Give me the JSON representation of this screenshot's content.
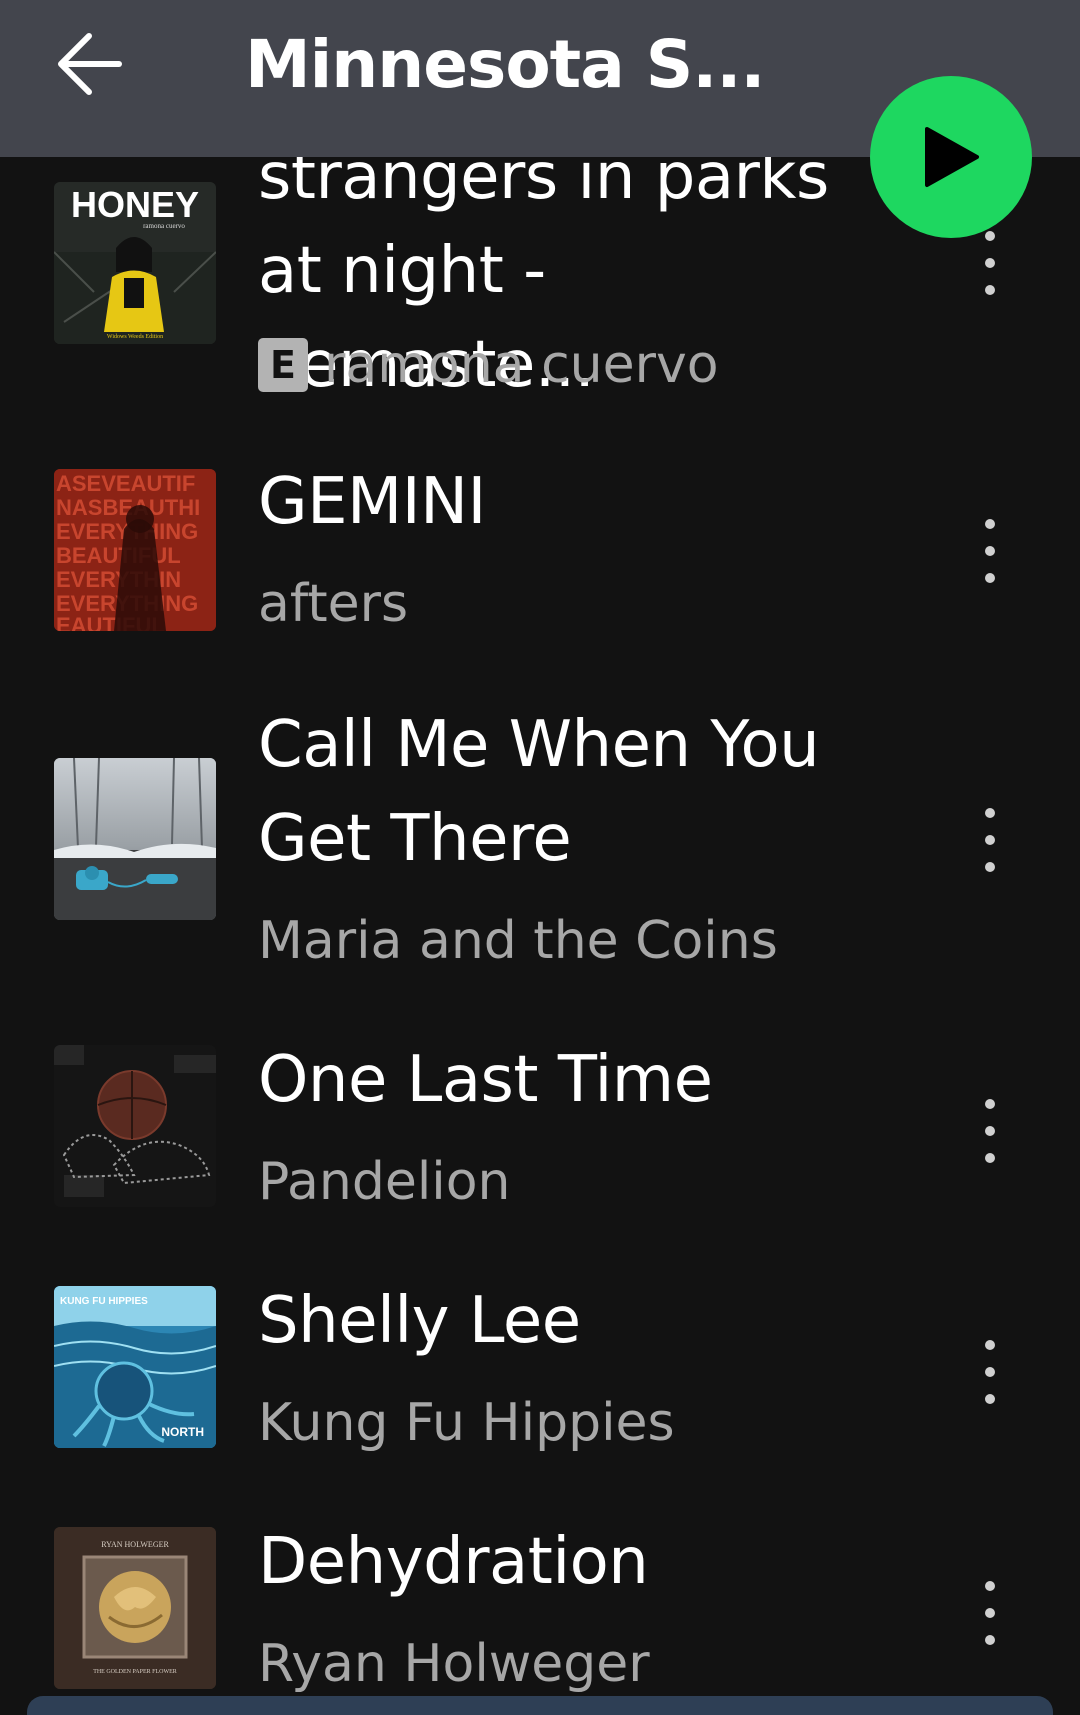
{
  "header": {
    "title": "Minnesota S..."
  },
  "icons": {
    "back": "arrow-left-icon",
    "play": "play-icon",
    "more": "more-vertical-icon"
  },
  "colors": {
    "accent": "#1ed760",
    "header_bg": "#43454d",
    "background": "#121212",
    "secondary_text": "#a7a7a7"
  },
  "tracks": [
    {
      "title_line1": "strangers in parks",
      "title_line2": "at night - Remaste...",
      "explicit_label": "E",
      "artist": "ramona cuervo",
      "art_text": "HONEY",
      "art_subtext": "ramona cuervo",
      "art_footer": "Widows Weeds Edition"
    },
    {
      "title_line1": "GEMINI",
      "artist": "afters",
      "art_text": "ASEVEAUTIFUL NASBEAUTHING EVERYTHING BEAUTIFUL EVERYTHING"
    },
    {
      "title_line1": "Call Me When You",
      "title_line2": "Get There",
      "artist": "Maria and the Coins"
    },
    {
      "title_line1": "One Last Time",
      "artist": "Pandelion"
    },
    {
      "title_line1": "Shelly Lee",
      "artist": "Kung Fu Hippies",
      "art_text": "KUNG FU HIPPIES",
      "art_footer": "NORTH"
    },
    {
      "title_line1": "Dehydration",
      "artist": "Ryan Holweger",
      "art_text": "RYAN HOLWEGER",
      "art_footer": "THE GOLDEN PAPER FLOWER"
    }
  ]
}
